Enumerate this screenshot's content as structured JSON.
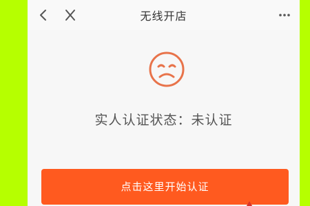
{
  "topbar": {
    "title": "无线开店"
  },
  "icons": {
    "back": "chevron-left-icon",
    "close": "close-icon",
    "more": "more-dots-icon",
    "status": "sad-face-icon"
  },
  "status": {
    "label": "实人认证状态：未认证"
  },
  "actions": {
    "start_label": "点击这里开始认证"
  },
  "colors": {
    "accent": "#ff5a1f",
    "face": "#e8734a",
    "frame": "#b6ff00"
  }
}
